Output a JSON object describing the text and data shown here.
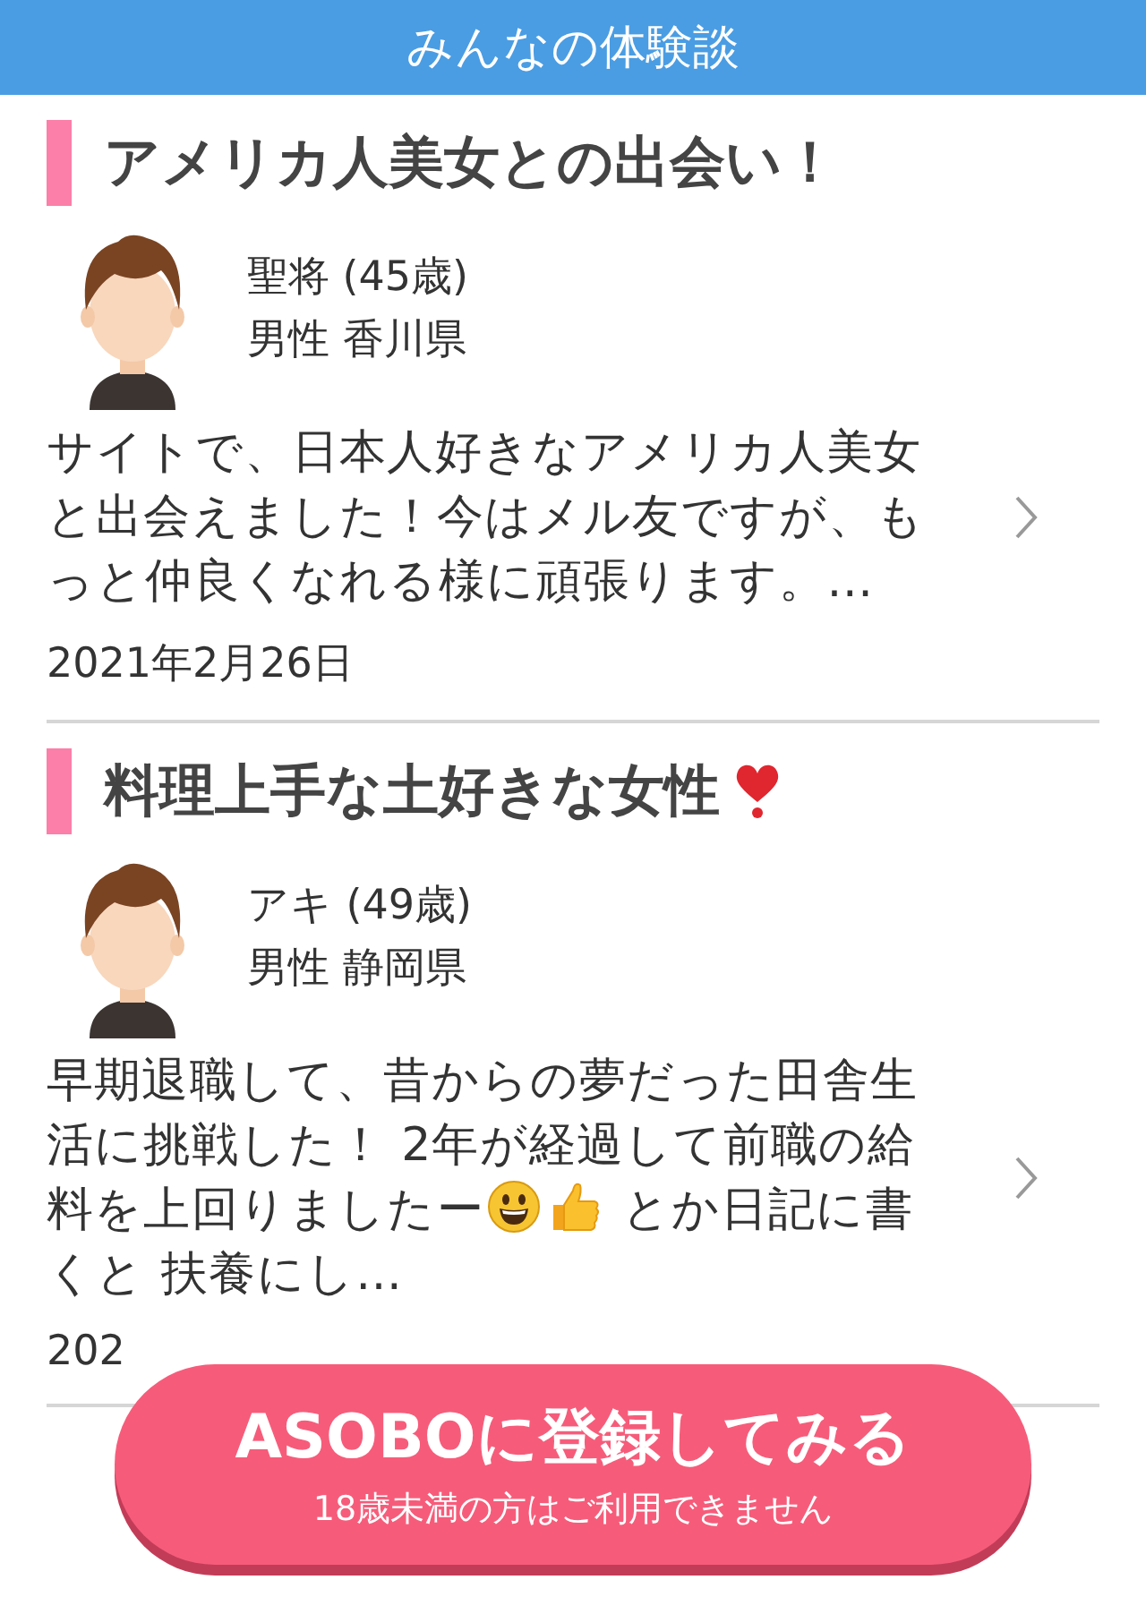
{
  "header": {
    "title": "みんなの体験談"
  },
  "stories": [
    {
      "title": [
        {
          "kind": "text",
          "text": "アメリカ人美女との出会い！"
        }
      ],
      "name": "聖将 (45歳)",
      "profile": "男性 香川県",
      "excerpt": [
        {
          "kind": "text",
          "text": "サイトで、日本人好きなアメリカ人美女と出会えました！今はメル友ですが、もっと仲良くなれる様に頑張ります。…"
        }
      ],
      "date": "2021年2月26日"
    },
    {
      "title": [
        {
          "kind": "text",
          "text": "料理上手な土好きな女性"
        },
        {
          "kind": "heart"
        }
      ],
      "name": "アキ (49歳)",
      "profile": "男性 静岡県",
      "excerpt": [
        {
          "kind": "text",
          "text": "早期退職して、昔からの夢だった田舎生活に挑戦した！ 2年が経過して前職の給料を上回りましたー"
        },
        {
          "kind": "smiley"
        },
        {
          "kind": "thumbs-up"
        },
        {
          "kind": "text",
          "text": " とか日記に書くと 扶養にし…"
        }
      ],
      "date": "202"
    }
  ],
  "cta": {
    "label": "ASOBOに登録してみる",
    "note": "18歳未満の方はご利用できません"
  }
}
